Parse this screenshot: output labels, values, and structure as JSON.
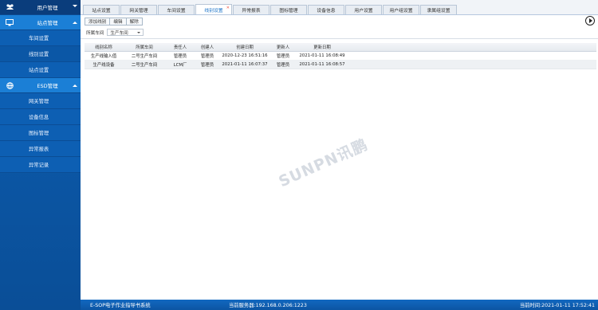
{
  "sidebar": {
    "header": {
      "label": "用户管理",
      "icon": "users-icon"
    },
    "groups": [
      {
        "label": "站点管理",
        "icon": "monitor-icon",
        "items": [
          "车间设置",
          "线别设置",
          "站点设置"
        ]
      },
      {
        "label": "ESD管理",
        "icon": "globe-icon",
        "items": [
          "网关管理",
          "设备信息",
          "图标管理",
          "异常报表",
          "异常记录"
        ]
      }
    ]
  },
  "tabs": [
    "站点设置",
    "网关管理",
    "车间设置",
    "线别设置",
    "异常报表",
    "图标管理",
    "设备信息",
    "用户设置",
    "用户组设置",
    "隶属组设置"
  ],
  "active_tab": "线别设置",
  "toolbar": {
    "add": "添加线别",
    "edit": "编辑",
    "delete": "解除"
  },
  "filter": {
    "label": "所属车间",
    "value": "生产车间"
  },
  "table": {
    "headers": [
      "线别名称",
      "所属车间",
      "责任人",
      "创建人",
      "创建日期",
      "更新人",
      "更新日期",
      ""
    ],
    "rows": [
      [
        "生产线输入值",
        "二号生产车间",
        "管理员",
        "管理员",
        "2020-12-23 16:51:16",
        "管理员",
        "2021-01-11 16:08:49",
        ""
      ],
      [
        "生产线设备",
        "二号生产车间",
        "LCM厂",
        "管理员",
        "2021-01-11 16:07:37",
        "管理员",
        "2021-01-11 16:08:57",
        ""
      ]
    ]
  },
  "watermark": "SUNPN讯鹏",
  "status": {
    "app": "E-SOP电子作业指导书系统",
    "server": "当前服务器:192.168.0.206:1223",
    "time": "当前时间:2021-01-11 17:52:41"
  }
}
